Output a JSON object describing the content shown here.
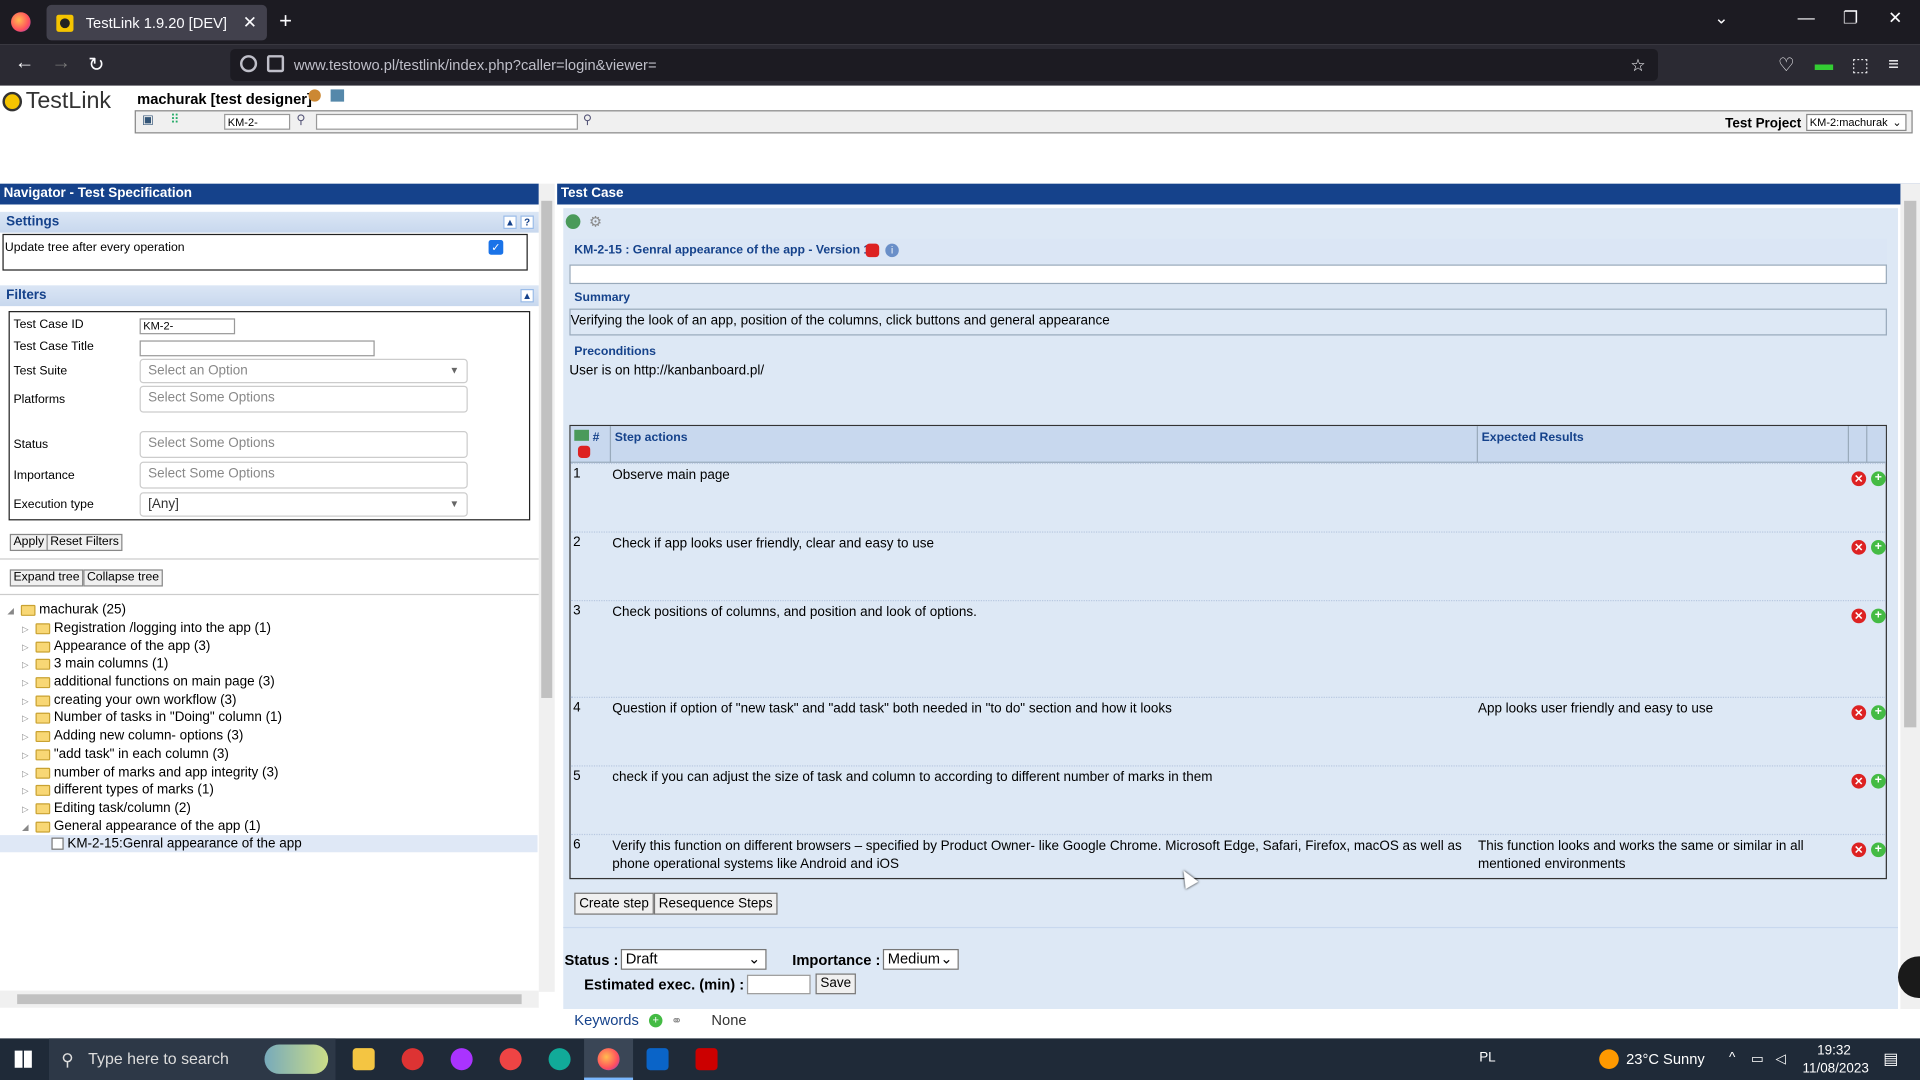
{
  "browser": {
    "tab_title": "TestLink 1.9.20 [DEV]",
    "url": "www.testowo.pl/testlink/index.php?caller=login&viewer="
  },
  "header": {
    "logo": "TestLink",
    "user": "machurak [test designer]",
    "search_value": "KM-2-",
    "test_project_label": "Test Project",
    "test_project_value": "KM-2:machurak"
  },
  "navigator": {
    "title": "Navigator - Test Specification",
    "settings_label": "Settings",
    "update_tree_label": "Update tree after every operation",
    "filters_label": "Filters",
    "filters": {
      "test_case_id_label": "Test Case ID",
      "test_case_id_value": "KM-2-",
      "test_case_title_label": "Test Case Title",
      "test_suite_label": "Test Suite",
      "test_suite_placeholder": "Select an Option",
      "platforms_label": "Platforms",
      "platforms_placeholder": "Select Some Options",
      "status_label": "Status",
      "status_placeholder": "Select Some Options",
      "importance_label": "Importance",
      "importance_placeholder": "Select Some Options",
      "execution_type_label": "Execution type",
      "execution_type_value": "[Any]"
    },
    "apply_label": "Apply",
    "reset_label": "Reset Filters",
    "expand_label": "Expand tree",
    "collapse_label": "Collapse tree",
    "tree": [
      "machurak (25)",
      "Registration /logging into the app (1)",
      "Appearance of the app (3)",
      "3 main columns (1)",
      "additional functions on main page (3)",
      "creating your own workflow (3)",
      "Number of tasks in \"Doing\" column (1)",
      "Adding new column- options (3)",
      "\"add task\" in each column (3)",
      "number of marks and app integrity (3)",
      "different types of marks (1)",
      "Editing task/column (2)",
      "General appearance of the app (1)",
      "KM-2-15:Genral appearance of the app"
    ]
  },
  "testcase": {
    "panel_title": "Test Case",
    "heading": "KM-2-15 : Genral appearance of the app - Version 1",
    "summary_label": "Summary",
    "summary": "Verifying the look of an app, position of the columns, click buttons and general appearance",
    "preconditions_label": "Preconditions",
    "preconditions": "User is on http://kanbanboard.pl/",
    "col_num": "#",
    "col_actions": "Step actions",
    "col_expected": "Expected Results",
    "steps": [
      {
        "n": "1",
        "action": "Observe main page",
        "expected": ""
      },
      {
        "n": "2",
        "action": "Check if app looks user friendly, clear and easy to use",
        "expected": ""
      },
      {
        "n": "3",
        "action": "Check positions of columns, and position and look of options.",
        "expected": ""
      },
      {
        "n": "4",
        "action": "Question if option of \"new task\" and \"add task\" both needed in \"to do\" section and how it looks",
        "expected": "App looks user friendly and easy to use"
      },
      {
        "n": "5",
        "action": "check if you can adjust the size of task and column to according to different number of marks in them",
        "expected": ""
      },
      {
        "n": "6",
        "action": "Verify this function on different browsers – specified by Product Owner- like Google Chrome. Microsoft Edge, Safari, Firefox, macOS as well as phone operational  systems like Android and iOS",
        "expected": "This function looks and works the same or similar in all mentioned environments"
      }
    ],
    "create_step": "Create step",
    "resequence": "Resequence Steps",
    "status_label": "Status :",
    "status_value": "Draft",
    "importance_label": "Importance :",
    "importance_value": "Medium",
    "estimated_label": "Estimated exec. (min) :",
    "save_label": "Save",
    "keywords_label": "Keywords",
    "keywords_value": "None"
  },
  "taskbar": {
    "search_placeholder": "Type here to search",
    "lang": "PL",
    "weather": "23°C  Sunny",
    "time": "19:32",
    "date": "11/08/2023"
  }
}
